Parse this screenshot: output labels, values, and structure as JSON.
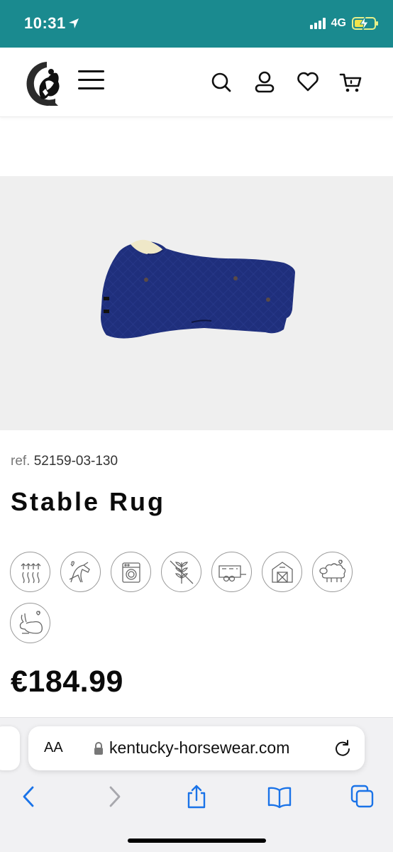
{
  "status_bar": {
    "time": "10:31",
    "network": "4G",
    "color": "#1a8a8f"
  },
  "header": {
    "logo_icon": "kentucky-logo",
    "menu_icon": "hamburger-icon",
    "search_icon": "search-icon",
    "account_icon": "user-icon",
    "wishlist_icon": "heart-icon",
    "cart_icon": "cart-icon"
  },
  "product": {
    "image_icon": "stable-rug-image",
    "ref_label": "ref.",
    "ref_value": "52159-03-130",
    "title": "Stable Rug",
    "price": "€184.99",
    "features": [
      "breathable-icon",
      "horse-comfort-icon",
      "washing-machine-icon",
      "no-grain-icon",
      "horse-trailer-icon",
      "stable-barn-icon",
      "sheep-wool-icon",
      "rabbit-icon"
    ]
  },
  "browser": {
    "text_size_label": "AA",
    "url": "kentucky-horsewear.com",
    "toolbar": [
      "back-icon",
      "forward-icon",
      "share-icon",
      "bookmarks-icon",
      "tabs-icon"
    ]
  }
}
